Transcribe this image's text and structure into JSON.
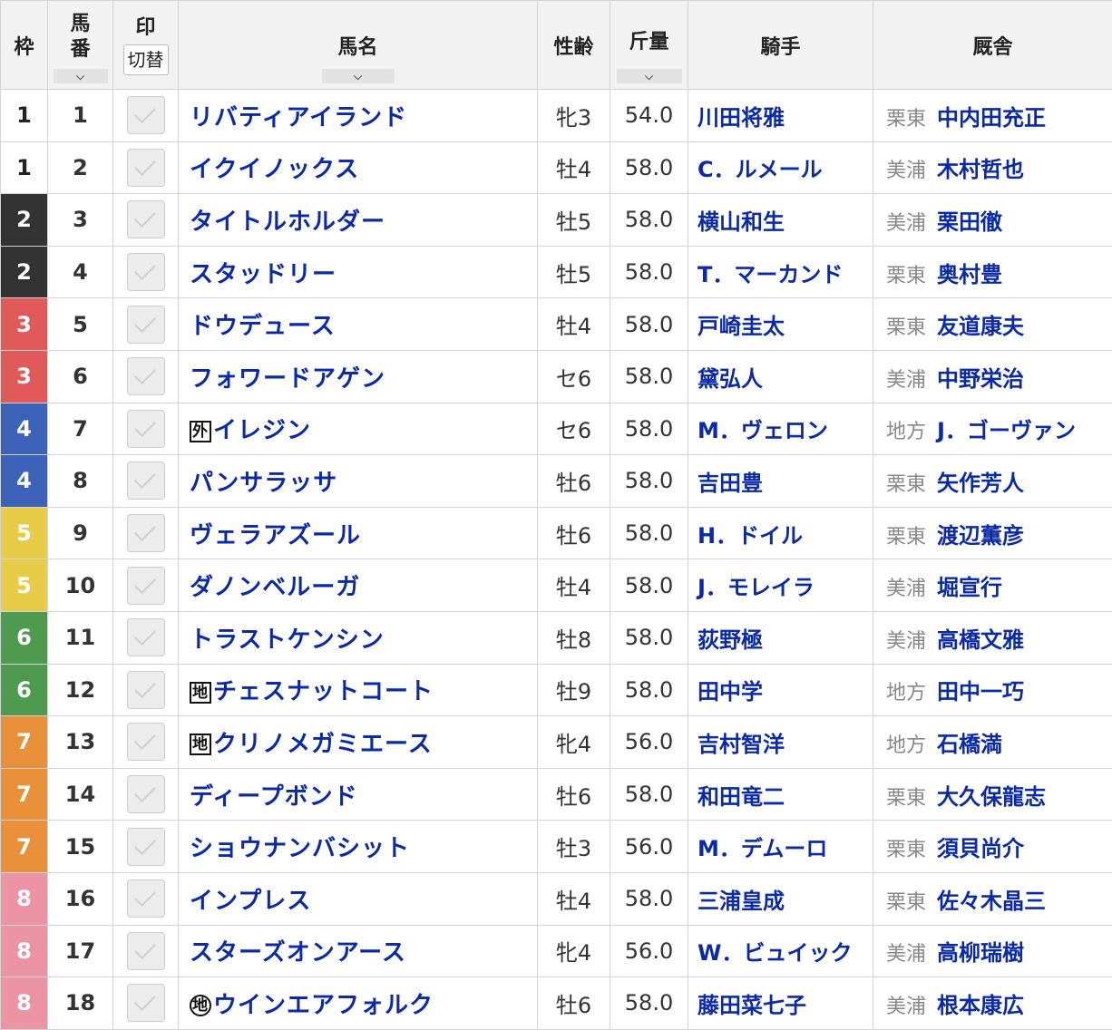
{
  "headers": {
    "waku": "枠",
    "umaban_top": "馬",
    "umaban_bottom": "番",
    "shirushi": "印",
    "toggle": "切替",
    "name": "馬名",
    "sexage": "性齢",
    "weight": "斤量",
    "jockey": "騎手",
    "trainer": "厩舎",
    "sort_icon": "⌵"
  },
  "colors": {
    "waku_1": "#ffffff",
    "waku_2": "#333333",
    "waku_3": "#e05a5a",
    "waku_4": "#3c63b8",
    "waku_5": "#e8cc48",
    "waku_6": "#4e9a4e",
    "waku_7": "#e8913a",
    "waku_8": "#ec93a6"
  },
  "rows": [
    {
      "waku": "1",
      "umaban": "1",
      "mark": "",
      "name": "リバティアイランド",
      "sexage": "牝3",
      "weight": "54.0",
      "jockey": "川田将雅",
      "region": "栗東",
      "trainer": "中内田充正"
    },
    {
      "waku": "1",
      "umaban": "2",
      "mark": "",
      "name": "イクイノックス",
      "sexage": "牡4",
      "weight": "58.0",
      "jockey": "C．ルメール",
      "region": "美浦",
      "trainer": "木村哲也"
    },
    {
      "waku": "2",
      "umaban": "3",
      "mark": "",
      "name": "タイトルホルダー",
      "sexage": "牡5",
      "weight": "58.0",
      "jockey": "横山和生",
      "region": "美浦",
      "trainer": "栗田徹"
    },
    {
      "waku": "2",
      "umaban": "4",
      "mark": "",
      "name": "スタッドリー",
      "sexage": "牡5",
      "weight": "58.0",
      "jockey": "T．マーカンド",
      "region": "栗東",
      "trainer": "奥村豊"
    },
    {
      "waku": "3",
      "umaban": "5",
      "mark": "",
      "name": "ドウデュース",
      "sexage": "牡4",
      "weight": "58.0",
      "jockey": "戸崎圭太",
      "region": "栗東",
      "trainer": "友道康夫"
    },
    {
      "waku": "3",
      "umaban": "6",
      "mark": "",
      "name": "フォワードアゲン",
      "sexage": "セ6",
      "weight": "58.0",
      "jockey": "黛弘人",
      "region": "美浦",
      "trainer": "中野栄治"
    },
    {
      "waku": "4",
      "umaban": "7",
      "mark": "外",
      "name": "イレジン",
      "sexage": "セ6",
      "weight": "58.0",
      "jockey": "M．ヴェロン",
      "region": "地方",
      "trainer": "J．ゴーヴァン"
    },
    {
      "waku": "4",
      "umaban": "8",
      "mark": "",
      "name": "パンサラッサ",
      "sexage": "牡6",
      "weight": "58.0",
      "jockey": "吉田豊",
      "region": "栗東",
      "trainer": "矢作芳人"
    },
    {
      "waku": "5",
      "umaban": "9",
      "mark": "",
      "name": "ヴェラアズール",
      "sexage": "牡6",
      "weight": "58.0",
      "jockey": "H．ドイル",
      "region": "栗東",
      "trainer": "渡辺薫彦"
    },
    {
      "waku": "5",
      "umaban": "10",
      "mark": "",
      "name": "ダノンベルーガ",
      "sexage": "牡4",
      "weight": "58.0",
      "jockey": "J．モレイラ",
      "region": "美浦",
      "trainer": "堀宣行"
    },
    {
      "waku": "6",
      "umaban": "11",
      "mark": "",
      "name": "トラストケンシン",
      "sexage": "牡8",
      "weight": "58.0",
      "jockey": "荻野極",
      "region": "美浦",
      "trainer": "高橋文雅"
    },
    {
      "waku": "6",
      "umaban": "12",
      "mark": "地",
      "name": "チェスナットコート",
      "sexage": "牡9",
      "weight": "58.0",
      "jockey": "田中学",
      "region": "地方",
      "trainer": "田中一巧"
    },
    {
      "waku": "7",
      "umaban": "13",
      "mark": "地",
      "name": "クリノメガミエース",
      "sexage": "牝4",
      "weight": "56.0",
      "jockey": "吉村智洋",
      "region": "地方",
      "trainer": "石橋満"
    },
    {
      "waku": "7",
      "umaban": "14",
      "mark": "",
      "name": "ディープボンド",
      "sexage": "牡6",
      "weight": "58.0",
      "jockey": "和田竜二",
      "region": "栗東",
      "trainer": "大久保龍志"
    },
    {
      "waku": "7",
      "umaban": "15",
      "mark": "",
      "name": "ショウナンバシット",
      "sexage": "牡3",
      "weight": "56.0",
      "jockey": "M．デムーロ",
      "region": "栗東",
      "trainer": "須貝尚介"
    },
    {
      "waku": "8",
      "umaban": "16",
      "mark": "",
      "name": "インプレス",
      "sexage": "牡4",
      "weight": "58.0",
      "jockey": "三浦皇成",
      "region": "栗東",
      "trainer": "佐々木晶三"
    },
    {
      "waku": "8",
      "umaban": "17",
      "mark": "",
      "name": "スターズオンアース",
      "sexage": "牝4",
      "weight": "56.0",
      "jockey": "W．ビュイック",
      "region": "美浦",
      "trainer": "高柳瑞樹"
    },
    {
      "waku": "8",
      "umaban": "18",
      "mark": "地c",
      "name": "ウインエアフォルク",
      "sexage": "牡6",
      "weight": "58.0",
      "jockey": "藤田菜七子",
      "region": "美浦",
      "trainer": "根本康広"
    }
  ]
}
